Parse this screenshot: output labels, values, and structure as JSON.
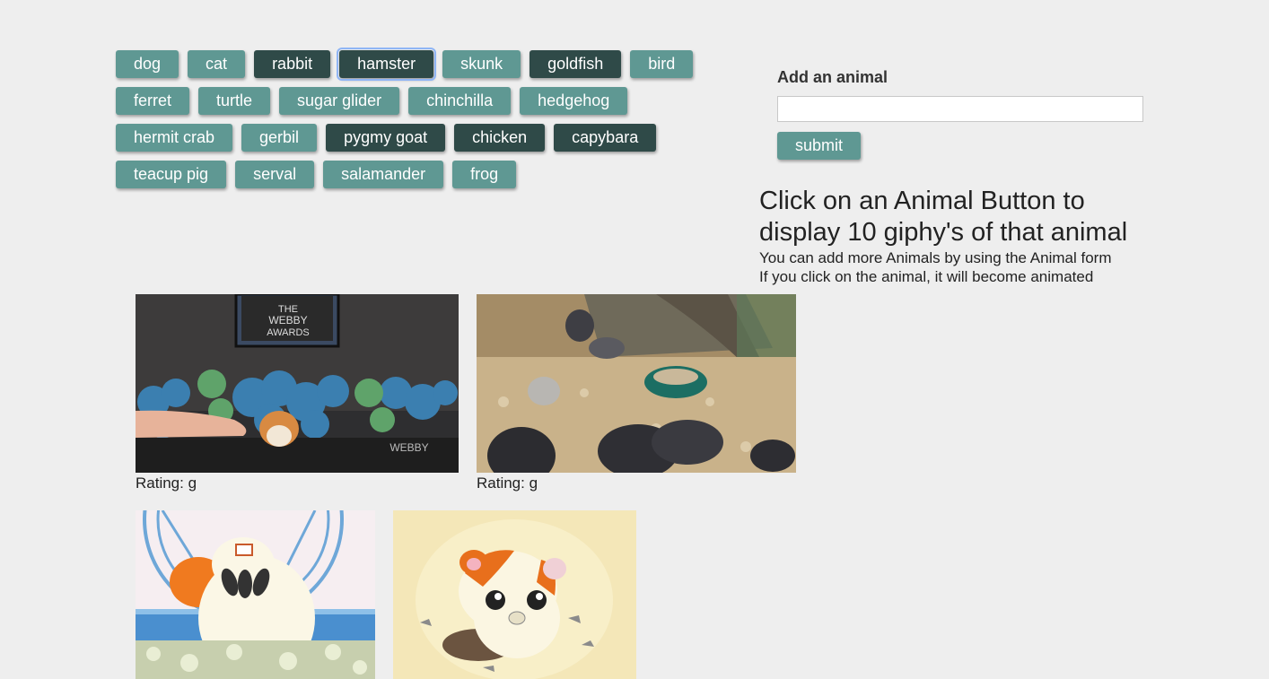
{
  "buttons": {
    "rows": [
      [
        {
          "label": "dog",
          "style": "light"
        },
        {
          "label": "cat",
          "style": "light"
        },
        {
          "label": "rabbit",
          "style": "dark"
        },
        {
          "label": "hamster",
          "style": "dark",
          "focused": true
        },
        {
          "label": "skunk",
          "style": "light"
        },
        {
          "label": "goldfish",
          "style": "dark"
        },
        {
          "label": "bird",
          "style": "light"
        }
      ],
      [
        {
          "label": "ferret",
          "style": "light"
        },
        {
          "label": "turtle",
          "style": "light"
        },
        {
          "label": "sugar glider",
          "style": "light"
        },
        {
          "label": "chinchilla",
          "style": "light"
        },
        {
          "label": "hedgehog",
          "style": "light"
        }
      ],
      [
        {
          "label": "hermit crab",
          "style": "light"
        },
        {
          "label": "gerbil",
          "style": "light"
        },
        {
          "label": "pygmy goat",
          "style": "dark"
        },
        {
          "label": "chicken",
          "style": "dark"
        },
        {
          "label": "capybara",
          "style": "dark"
        }
      ],
      [
        {
          "label": "teacup pig",
          "style": "light"
        },
        {
          "label": "serval",
          "style": "light"
        },
        {
          "label": "salamander",
          "style": "light"
        },
        {
          "label": "frog",
          "style": "light"
        }
      ]
    ]
  },
  "form": {
    "label": "Add an animal",
    "input_value": "",
    "submit_label": "submit"
  },
  "info": {
    "heading": "Click on an Animal Button to display 10 giphy's of that animal",
    "line1": "You can add more Animals by using the Animal form",
    "line2": "If you click on the animal, it will become animated"
  },
  "gifs": [
    {
      "rating_text": "Rating: g",
      "watermark": "THE WEBBY AWARDS"
    },
    {
      "rating_text": "Rating: g"
    },
    {
      "rating_text": ""
    },
    {
      "rating_text": ""
    }
  ],
  "colors": {
    "button_light": "#5f9893",
    "button_dark": "#2f4a48",
    "background": "#eeeeee"
  }
}
